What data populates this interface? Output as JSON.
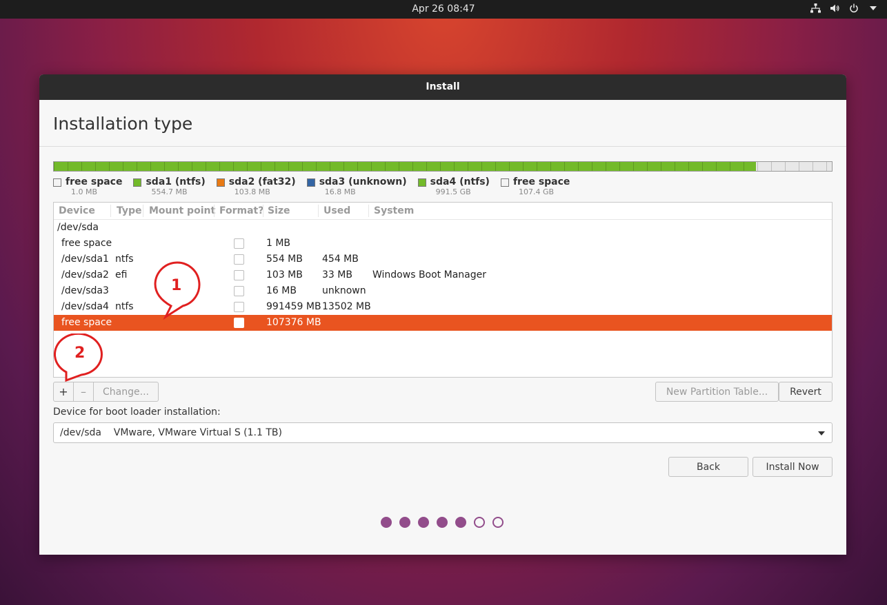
{
  "topbar": {
    "clock": "Apr 26  08:47"
  },
  "window": {
    "title": "Install",
    "heading": "Installation type"
  },
  "disk": {
    "segments": [
      {
        "fraction": 1e-05,
        "color": "#e8e8e8"
      },
      {
        "fraction": 0.0005,
        "color": "#73ba2a"
      },
      {
        "fraction": 0.0001,
        "color": "#e87a14"
      },
      {
        "fraction": 2e-05,
        "color": "#3465a4"
      },
      {
        "fraction": 0.9023,
        "color": "#73ba2a"
      },
      {
        "fraction": 0.0971,
        "color": "#e8e8e8"
      }
    ]
  },
  "legend": [
    {
      "name": "free space",
      "size": "1.0 MB",
      "color": "#f4f4f4"
    },
    {
      "name": "sda1 (ntfs)",
      "size": "554.7 MB",
      "color": "#73ba2a"
    },
    {
      "name": "sda2 (fat32)",
      "size": "103.8 MB",
      "color": "#e87a14"
    },
    {
      "name": "sda3 (unknown)",
      "size": "16.8 MB",
      "color": "#3465a4"
    },
    {
      "name": "sda4 (ntfs)",
      "size": "991.5 GB",
      "color": "#73ba2a"
    },
    {
      "name": "free space",
      "size": "107.4 GB",
      "color": "#f4f4f4"
    }
  ],
  "table": {
    "headers": [
      "Device",
      "Type",
      "Mount point",
      "Format?",
      "Size",
      "Used",
      "System"
    ],
    "group": "/dev/sda",
    "rows": [
      {
        "device": "free space",
        "type": "",
        "size": "1 MB",
        "used": "",
        "system": ""
      },
      {
        "device": "/dev/sda1",
        "type": "ntfs",
        "size": "554 MB",
        "used": "454 MB",
        "system": ""
      },
      {
        "device": "/dev/sda2",
        "type": "efi",
        "size": "103 MB",
        "used": "33 MB",
        "system": "Windows Boot Manager"
      },
      {
        "device": "/dev/sda3",
        "type": "",
        "size": "16 MB",
        "used": "unknown",
        "system": ""
      },
      {
        "device": "/dev/sda4",
        "type": "ntfs",
        "size": "991459 MB",
        "used": "13502 MB",
        "system": ""
      },
      {
        "device": "free space",
        "type": "",
        "size": "107376 MB",
        "used": "",
        "system": ""
      }
    ]
  },
  "buttons": {
    "add": "+",
    "remove": "–",
    "change": "Change...",
    "new_table": "New Partition Table...",
    "revert": "Revert",
    "back": "Back",
    "install": "Install Now"
  },
  "bootloader": {
    "label": "Device for boot loader installation:",
    "value": "/dev/sda    VMware, VMware Virtual S (1.1 TB)"
  },
  "progress": {
    "completed_steps": 5,
    "total_steps": 7
  },
  "annotations": {
    "first": "1",
    "second": "2"
  }
}
